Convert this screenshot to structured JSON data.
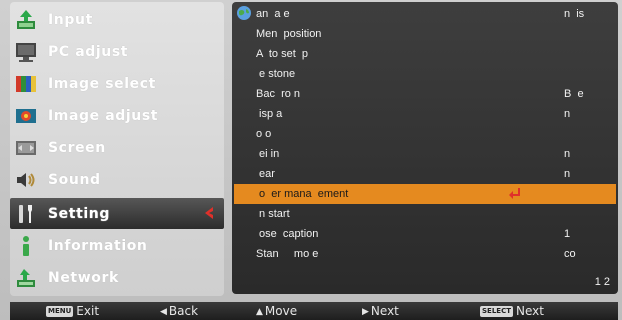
{
  "menu": {
    "items": [
      {
        "label": "Input",
        "icon": "input-icon",
        "active": false
      },
      {
        "label": "PC adjust",
        "icon": "pc-adjust-icon",
        "active": false
      },
      {
        "label": "Image select",
        "icon": "image-select-icon",
        "active": false
      },
      {
        "label": "Image adjust",
        "icon": "image-adjust-icon",
        "active": false
      },
      {
        "label": "Screen",
        "icon": "screen-icon",
        "active": false
      },
      {
        "label": "Sound",
        "icon": "sound-icon",
        "active": false
      },
      {
        "label": "Setting",
        "icon": "setting-icon",
        "active": true
      },
      {
        "label": "Information",
        "icon": "information-icon",
        "active": false
      },
      {
        "label": "Network",
        "icon": "network-icon",
        "active": false
      }
    ]
  },
  "settings": {
    "rows": [
      {
        "label": "an  a e",
        "value": "n  is"
      },
      {
        "label": "Men  position",
        "value": ""
      },
      {
        "label": "A  to set  p",
        "value": ""
      },
      {
        "label": " e stone",
        "value": ""
      },
      {
        "label": "Bac  ro n",
        "value": "B  e"
      },
      {
        "label": " isp a",
        "value": "n"
      },
      {
        "label": "o o",
        "value": ""
      },
      {
        "label": " ei in",
        "value": "n"
      },
      {
        "label": " ear",
        "value": "n"
      },
      {
        "label": " o  er mana  ement",
        "value": ""
      },
      {
        "label": " n start",
        "value": ""
      },
      {
        "label": " ose  caption",
        "value": "1"
      },
      {
        "label": "Stan     mo e",
        "value": "co"
      }
    ],
    "highlight_index": 9,
    "page": "1 2"
  },
  "bottom_bar": {
    "exit_key": "MENU",
    "exit_label": "Exit",
    "back_label": "Back",
    "move_label": "Move",
    "next_label": "Next",
    "select_key": "SELECT",
    "select_label": "Next"
  },
  "colors": {
    "highlight": "#e58a1f",
    "active_arrow": "#e0302a",
    "panel_bg": "#333333"
  }
}
